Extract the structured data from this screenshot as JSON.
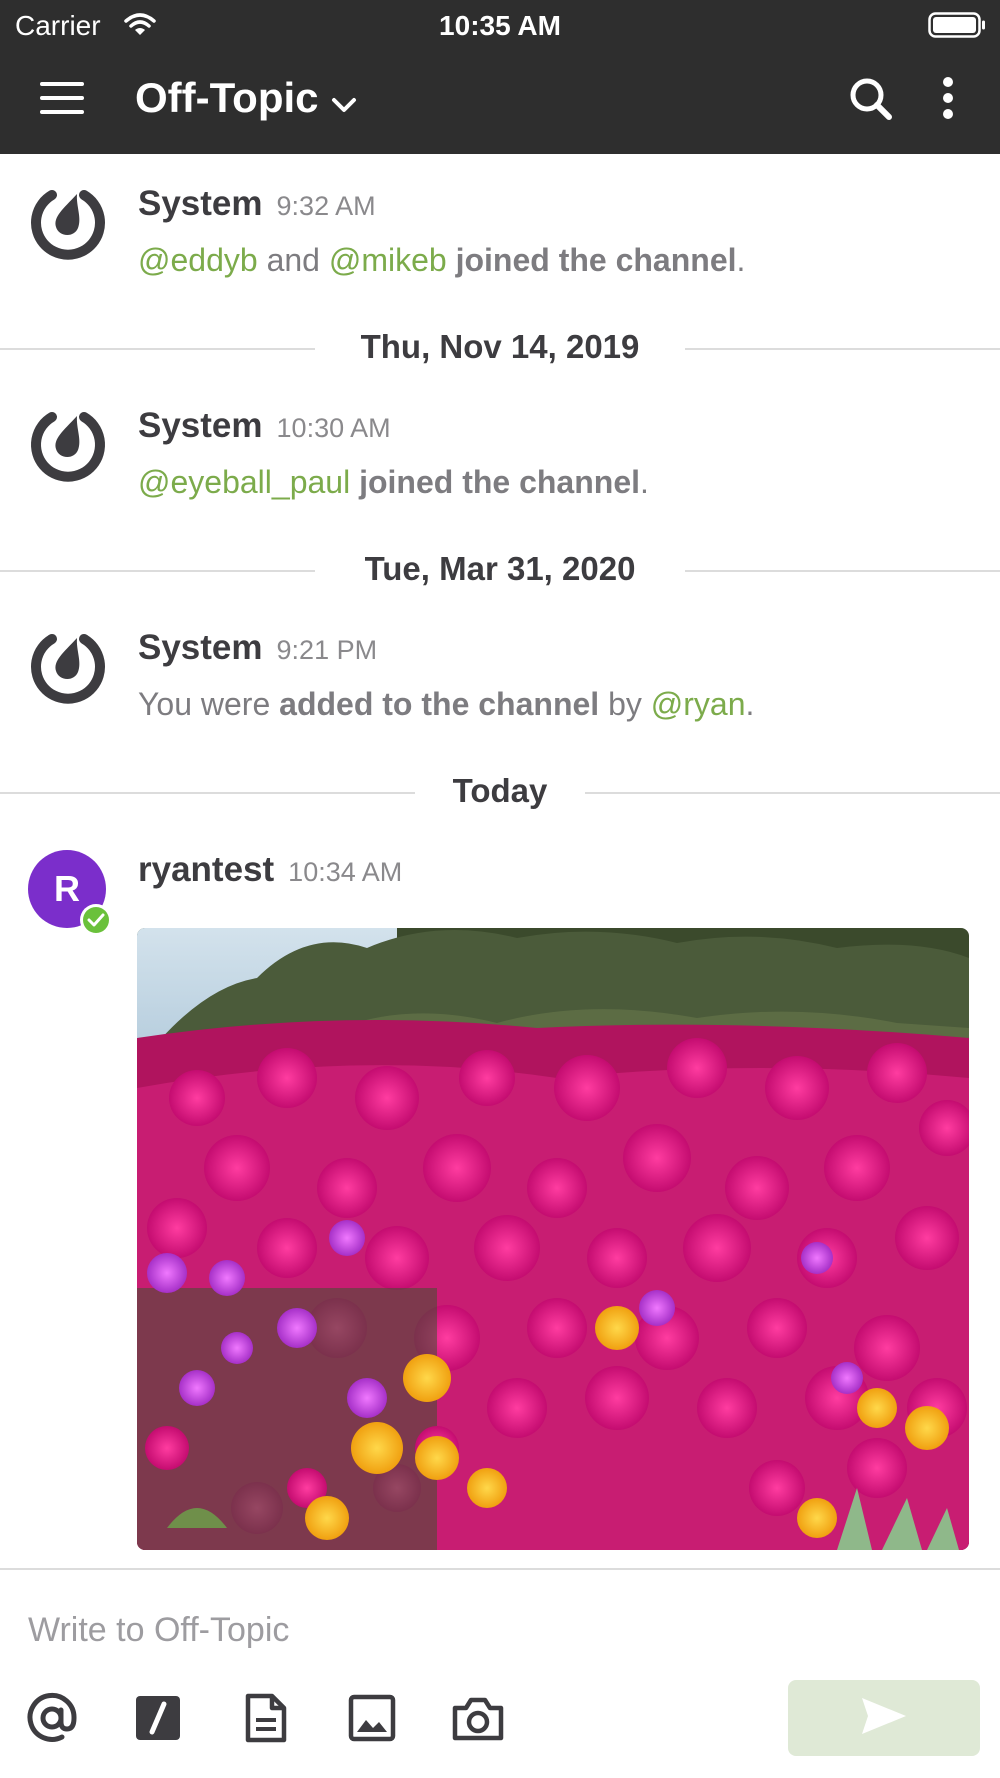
{
  "status_bar": {
    "carrier": "Carrier",
    "time": "10:35 AM"
  },
  "header": {
    "channel_name": "Off-Topic"
  },
  "posts": [
    {
      "author": "System",
      "time": "9:32 AM",
      "mentions": [
        "@eddyb",
        "@mikeb"
      ],
      "and": "and",
      "action": "joined the channel",
      "end": "."
    },
    {
      "author": "System",
      "time": "10:30 AM",
      "mention": "@eyeball_paul",
      "action": "joined the channel",
      "end": "."
    },
    {
      "author": "System",
      "time": "9:21 PM",
      "prefix": "You were",
      "action": "added to the channel",
      "by": "by",
      "mention": "@ryan",
      "end": "."
    },
    {
      "author": "ryantest",
      "time": "10:34 AM",
      "avatar_initial": "R"
    }
  ],
  "date_separators": [
    "Thu, Nov 14, 2019",
    "Tue, Mar 31, 2020",
    "Today"
  ],
  "composer": {
    "placeholder": "Write to Off-Topic"
  },
  "icons": {
    "status": [
      "wifi-icon",
      "battery-icon"
    ],
    "header": [
      "hamburger-menu-icon",
      "chevron-down-icon",
      "search-icon",
      "more-vertical-icon"
    ],
    "composer": [
      "at-mention-icon",
      "slash-command-icon",
      "file-icon",
      "image-icon",
      "camera-icon",
      "send-icon"
    ]
  },
  "colors": {
    "header_bg": "#2e2e2e",
    "mention": "#7cab4b",
    "avatar_user": "#7b2ecb",
    "online": "#6ac13b",
    "send_disabled": "#dfe9d6"
  }
}
